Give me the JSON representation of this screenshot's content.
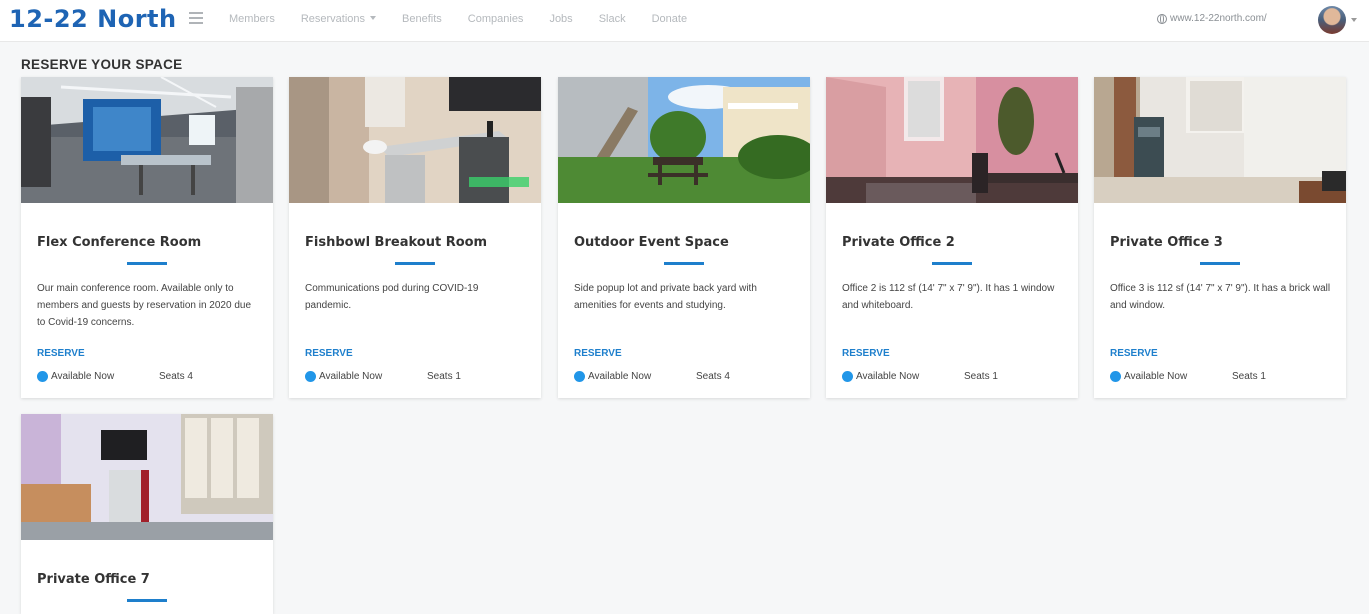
{
  "nav": {
    "brand": "12-22 North",
    "links": [
      "Members",
      "Reservations",
      "Benefits",
      "Companies",
      "Jobs",
      "Slack",
      "Donate"
    ],
    "website": "www.12-22north.com/"
  },
  "page": {
    "title": "RESERVE YOUR SPACE"
  },
  "cards": [
    {
      "title": "Flex Conference Room",
      "desc": "Our main conference room. Available only to members and guests by reservation in 2020 due to Covid-19 concerns.",
      "reserve": "RESERVE",
      "status": "Available Now",
      "seats": "Seats 4"
    },
    {
      "title": "Fishbowl Breakout Room",
      "desc": "Communications pod during COVID-19 pandemic.",
      "reserve": "RESERVE",
      "status": "Available Now",
      "seats": "Seats 1"
    },
    {
      "title": "Outdoor Event Space",
      "desc": "Side popup lot and private back yard with amenities for events and studying.",
      "reserve": "RESERVE",
      "status": "Available Now",
      "seats": "Seats 4"
    },
    {
      "title": "Private Office 2",
      "desc": "Office 2 is 112 sf (14' 7\" x 7' 9\"). It has 1 window and whiteboard.",
      "reserve": "RESERVE",
      "status": "Available Now",
      "seats": "Seats 1"
    },
    {
      "title": "Private Office 3",
      "desc": "Office 3 is 112 sf (14' 7\" x 7' 9\"). It has a brick wall and window.",
      "reserve": "RESERVE",
      "status": "Available Now",
      "seats": "Seats 1"
    },
    {
      "title": "Private Office 7"
    }
  ]
}
